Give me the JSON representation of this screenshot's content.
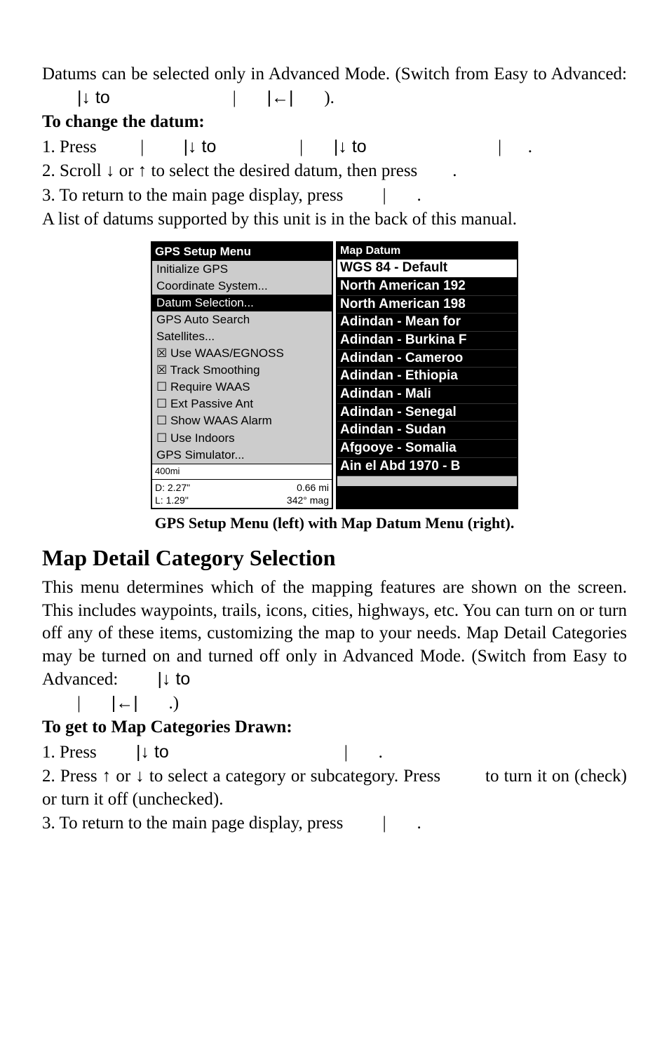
{
  "intro": {
    "p1_a": "Datums can be selected only in Advanced Mode. (Switch from Easy to Advanced:",
    "p1_b": "|↓ to",
    "p1_c": "|",
    "p1_d": "|←|",
    "p1_e": ")."
  },
  "change_heading": "To change the datum:",
  "step1": {
    "a": "1. Press",
    "b": "|",
    "c": "|↓ to",
    "d": "|",
    "e": "|↓ to",
    "f": "|",
    "g": "."
  },
  "step2": "2. Scroll ↓ or ↑ to select the desired datum, then press",
  "step2b": ".",
  "step3": {
    "a": "3. To return to the main page display, press",
    "b": "|",
    "c": "."
  },
  "listnote": "A list of datums supported by this unit is in the back of this manual.",
  "left_menu": {
    "title": "GPS Setup Menu",
    "items": [
      "Initialize GPS",
      "Coordinate System...",
      "Datum Selection...",
      "GPS Auto Search",
      "Satellites...",
      "☒ Use WAAS/EGNOSS",
      "☒ Track Smoothing",
      "☐ Require WAAS",
      "☐ Ext Passive Ant",
      "☐ Show WAAS Alarm",
      "☐ Use Indoors",
      "GPS Simulator..."
    ],
    "scale": "400mi",
    "footer_left_d": "D:    2.27\"",
    "footer_left_l": "L:    1.29\"",
    "footer_right_top": "0.66 mi",
    "footer_right_bot": "342° mag"
  },
  "right_menu": {
    "title": "Map Datum",
    "items": [
      "WGS 84 - Default",
      "North American 192",
      "North American 198",
      "Adindan - Mean for",
      "Adindan - Burkina F",
      "Adindan - Cameroo",
      "Adindan - Ethiopia",
      "Adindan - Mali",
      "Adindan - Senegal",
      "Adindan - Sudan",
      "Afgooye - Somalia",
      "Ain el Abd 1970 - B"
    ]
  },
  "caption": "GPS Setup Menu (left) with Map Datum Menu (right).",
  "h2": "Map Detail Category Selection",
  "para2a": "This menu determines which of the mapping features are shown on the screen. This includes waypoints, trails, icons, cities, highways, etc. You can turn on or turn off any of these items, customizing the map to your needs. Map Detail Categories may be turned on and turned off only in Advanced Mode. (Switch from Easy to Advanced:",
  "para2b": "|↓ to",
  "para2c": "|",
  "para2d": "|←|",
  "para2e": ".)",
  "cat_heading": "To get to Map Categories Drawn:",
  "cstep1": {
    "a": "1. Press",
    "b": "|↓ to",
    "c": "|",
    "d": "."
  },
  "cstep2a": "2. Press ↑ or ↓ to select a category or subcategory. Press",
  "cstep2b": "to turn it on (check) or turn it off (unchecked).",
  "cstep3": {
    "a": "3. To return to the main page display, press",
    "b": "|",
    "c": "."
  }
}
